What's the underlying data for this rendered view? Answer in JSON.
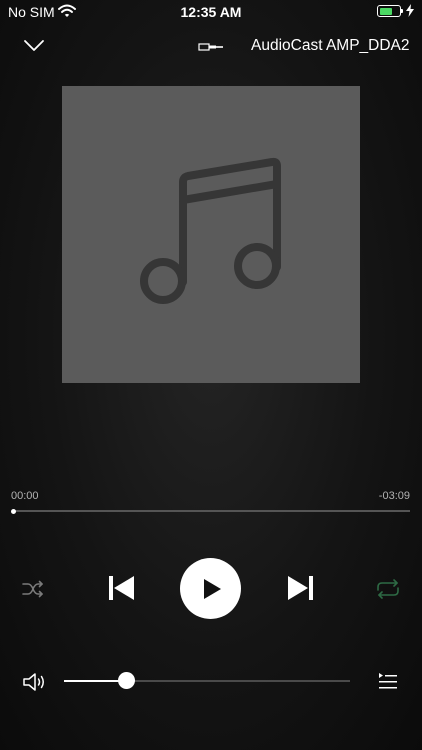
{
  "status_bar": {
    "carrier": "No SIM",
    "time": "12:35 AM",
    "battery_level": 0.72,
    "battery_color": "#4cd964"
  },
  "header": {
    "collapse_icon": "chevron-down-icon",
    "device_icon": "cable-plug-icon",
    "device_name": "AudioCast AMP_DDA2"
  },
  "artwork": {
    "placeholder_icon": "music-note-icon",
    "background": "#5b5b5b",
    "icon_color": "#363636"
  },
  "progress": {
    "elapsed": "00:00",
    "remaining": "-03:09",
    "fraction": 0.0
  },
  "controls": {
    "shuffle_icon": "shuffle-icon",
    "previous_icon": "skip-previous-icon",
    "play_icon": "play-icon",
    "next_icon": "skip-next-icon",
    "repeat_icon": "repeat-icon",
    "repeat_color": "#2e6b45"
  },
  "volume": {
    "icon": "volume-icon",
    "level": 0.22
  },
  "queue": {
    "icon": "queue-list-icon"
  }
}
